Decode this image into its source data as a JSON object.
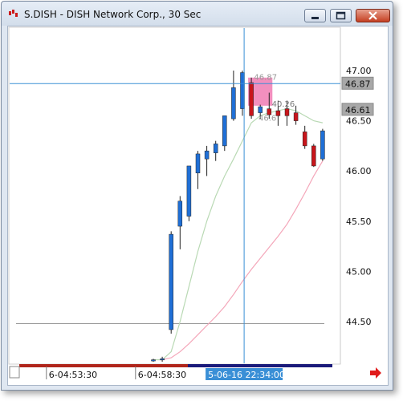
{
  "window": {
    "title": "S.DISH - DISH Network Corp., 30 Sec",
    "icons": [
      "app-chart-icon",
      "minimize-icon",
      "maximize-icon",
      "close-icon"
    ]
  },
  "colors": {
    "up_candle": "#1f6fd6",
    "down_candle": "#c8151b",
    "crosshair": "#3a8fd6",
    "ma_fast": "#b9d9b4",
    "ma_slow": "#f4a6b9",
    "highlight_box": "#f07bb3",
    "time_bar_red": "#b0251b",
    "time_bar_navy": "#1a1a7a",
    "crosshair_time_bg": "#3a8fd6",
    "scroll_arrow": "#e01a1a"
  },
  "chart_data": {
    "type": "candlestick",
    "symbol": "S.DISH",
    "interval": "30 Sec",
    "ylim": [
      44.1,
      47.3
    ],
    "y_ticks": [
      44.5,
      45.0,
      45.5,
      46.0,
      46.5,
      47.0
    ],
    "y_tick_labels": [
      "44.50",
      "45.00",
      "45.50",
      "46.00",
      "46.50",
      "47.00"
    ],
    "price_tags": [
      {
        "label": "46.87",
        "value": 46.87,
        "kind": "crosshair"
      },
      {
        "label": "46.61",
        "value": 46.61,
        "kind": "last"
      }
    ],
    "horizontal_line": 44.48,
    "candles": [
      {
        "o": 44.12,
        "h": 44.13,
        "l": 44.1,
        "c": 44.12
      },
      {
        "o": 44.12,
        "h": 44.15,
        "l": 44.1,
        "c": 44.13
      },
      {
        "o": 44.42,
        "h": 45.4,
        "l": 44.38,
        "c": 45.37
      },
      {
        "o": 45.45,
        "h": 45.75,
        "l": 45.22,
        "c": 45.7
      },
      {
        "o": 45.55,
        "h": 46.05,
        "l": 45.5,
        "c": 46.05
      },
      {
        "o": 45.98,
        "h": 46.2,
        "l": 45.82,
        "c": 46.17
      },
      {
        "o": 46.12,
        "h": 46.25,
        "l": 45.95,
        "c": 46.2
      },
      {
        "o": 46.18,
        "h": 46.3,
        "l": 46.1,
        "c": 46.27
      },
      {
        "o": 46.25,
        "h": 46.55,
        "l": 46.2,
        "c": 46.55
      },
      {
        "o": 46.52,
        "h": 47.0,
        "l": 46.5,
        "c": 46.83
      },
      {
        "o": 46.62,
        "h": 47.0,
        "l": 46.55,
        "c": 46.98
      },
      {
        "o": 46.88,
        "h": 46.93,
        "l": 46.52,
        "c": 46.55
      },
      {
        "o": 46.58,
        "h": 46.66,
        "l": 46.52,
        "c": 46.64
      },
      {
        "o": 46.62,
        "h": 46.78,
        "l": 46.52,
        "c": 46.56
      },
      {
        "o": 46.6,
        "h": 46.7,
        "l": 46.45,
        "c": 46.55
      },
      {
        "o": 46.62,
        "h": 46.7,
        "l": 46.45,
        "c": 46.55
      },
      {
        "o": 46.58,
        "h": 46.65,
        "l": 46.46,
        "c": 46.5
      },
      {
        "o": 46.39,
        "h": 46.45,
        "l": 46.22,
        "c": 46.25
      },
      {
        "o": 46.25,
        "h": 46.27,
        "l": 46.04,
        "c": 46.05
      },
      {
        "o": 46.12,
        "h": 46.42,
        "l": 46.1,
        "c": 46.4
      }
    ],
    "ma_fast": [
      44.12,
      44.12,
      44.2,
      44.5,
      44.85,
      45.2,
      45.5,
      45.75,
      45.95,
      46.12,
      46.3,
      46.48,
      46.55,
      46.58,
      46.6,
      46.62,
      46.6,
      46.55,
      46.5,
      46.48
    ],
    "ma_slow": [
      44.12,
      44.12,
      44.14,
      44.2,
      44.28,
      44.37,
      44.46,
      44.55,
      44.65,
      44.77,
      44.9,
      45.02,
      45.13,
      45.24,
      45.35,
      45.47,
      45.62,
      45.78,
      45.95,
      46.1
    ],
    "crosshair": {
      "candle_index": 11,
      "price": 46.87,
      "time_label": "5-06-16 22:34:00"
    },
    "overlay_text": [
      {
        "text": "46.87",
        "candle_index": 11.3,
        "price": 46.91,
        "color": "#9a9a9a"
      },
      {
        "text": "40.26",
        "candle_index": 13.3,
        "price": 46.64,
        "color": "#7a7a7a"
      },
      {
        "text": "46.6",
        "candle_index": 11.8,
        "price": 46.5,
        "color": "#9a9a9a"
      }
    ],
    "highlight": {
      "from_index": 11,
      "to_index": 13,
      "price_top": 46.93,
      "price_bottom": 46.65
    },
    "time_labels": [
      {
        "text": "6-04:53:30",
        "candle_index": -12
      },
      {
        "text": "6-04:58:30",
        "candle_index": -2
      }
    ],
    "grid": false,
    "legend": "none"
  }
}
